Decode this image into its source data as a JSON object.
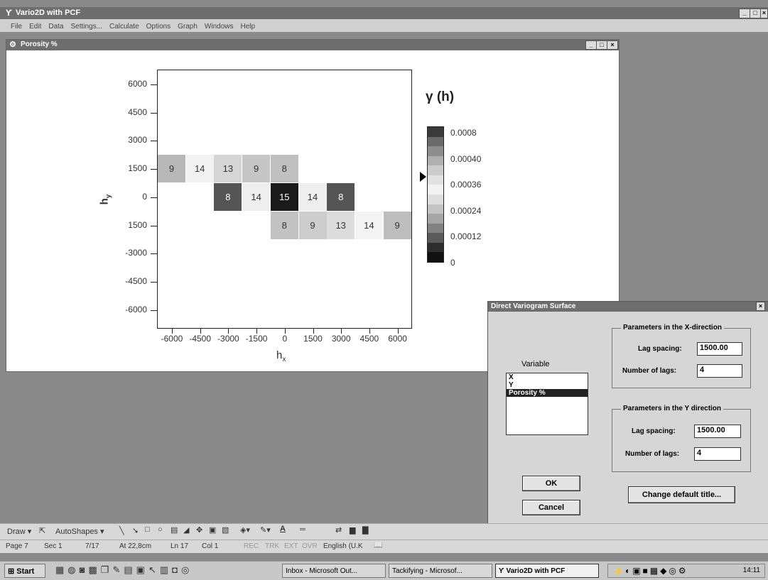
{
  "app": {
    "title": "Vario2D with PCF"
  },
  "menu": [
    "File",
    "Edit",
    "Data",
    "Settings...",
    "Calculate",
    "Options",
    "Graph",
    "Windows",
    "Help"
  ],
  "child_window": {
    "title": "Porosity %"
  },
  "plot": {
    "ylabel": "h",
    "ylabel_sub": "y",
    "xlabel": "h",
    "xlabel_sub": "x",
    "y_ticks": [
      "6000",
      "4500",
      "3000",
      "1500",
      "0",
      "1500",
      "-3000",
      "-4500",
      "-6000"
    ],
    "x_ticks": [
      "-6000",
      "-4500",
      "-3000",
      "-1500",
      "0",
      "1500",
      "3000",
      "4500",
      "6000"
    ],
    "cells": [
      {
        "col": 0,
        "row": 3,
        "label": "9",
        "shade": "#b8b8b8"
      },
      {
        "col": 1,
        "row": 3,
        "label": "14",
        "shade": "#f2f2f2"
      },
      {
        "col": 2,
        "row": 3,
        "label": "13",
        "shade": "#d6d6d6"
      },
      {
        "col": 3,
        "row": 3,
        "label": "9",
        "shade": "#c6c6c6"
      },
      {
        "col": 4,
        "row": 3,
        "label": "8",
        "shade": "#c0c0c0"
      },
      {
        "col": 2,
        "row": 4,
        "label": "8",
        "shade": "#555555"
      },
      {
        "col": 3,
        "row": 4,
        "label": "14",
        "shade": "#eeeeee"
      },
      {
        "col": 4,
        "row": 4,
        "label": "15",
        "shade": "#1a1a1a"
      },
      {
        "col": 5,
        "row": 4,
        "label": "14",
        "shade": "#eeeeee"
      },
      {
        "col": 6,
        "row": 4,
        "label": "8",
        "shade": "#555555"
      },
      {
        "col": 4,
        "row": 5,
        "label": "8",
        "shade": "#c2c2c2"
      },
      {
        "col": 5,
        "row": 5,
        "label": "9",
        "shade": "#cdcdcd"
      },
      {
        "col": 6,
        "row": 5,
        "label": "13",
        "shade": "#dcdcdc"
      },
      {
        "col": 7,
        "row": 5,
        "label": "14",
        "shade": "#f4f4f4"
      },
      {
        "col": 8,
        "row": 5,
        "label": "9",
        "shade": "#bdbdbd"
      }
    ]
  },
  "legend": {
    "title": "γ (h)",
    "labels": [
      "0.0008",
      "0.00040",
      "0.00036",
      "0.00024",
      "0.00012",
      "0"
    ],
    "swatches": [
      "#3a3a3a",
      "#6a6a6a",
      "#8e8e8e",
      "#b0b0b0",
      "#cccccc",
      "#e2e2e2",
      "#f2f2f2",
      "#dedede",
      "#c4c4c4",
      "#a6a6a6",
      "#828282",
      "#5a5a5a",
      "#2e2e2e",
      "#111111"
    ]
  },
  "dialog": {
    "title": "Direct Variogram Surface",
    "close": "×",
    "variable_label": "Variable",
    "variables": [
      "X",
      "Y",
      "Porosity %"
    ],
    "selected_variable": "Porosity %",
    "x_group": {
      "title": "Parameters in the X-direction",
      "lag_label": "Lag spacing:",
      "lag_value": "1500.00",
      "num_label": "Number of lags:",
      "num_value": "4"
    },
    "y_group": {
      "title": "Parameters in the Y direction",
      "lag_label": "Lag spacing:",
      "lag_value": "1500.00",
      "num_label": "Number of lags:",
      "num_value": "4"
    },
    "ok": "OK",
    "cancel": "Cancel",
    "change_title": "Change default title..."
  },
  "drawing_toolbar": {
    "draw": "Draw ▾",
    "autoshapes": "AutoShapes ▾"
  },
  "statusbar": {
    "page": "Page 7",
    "sec": "Sec 1",
    "pages": "7/17",
    "at": "At 22,8cm",
    "ln": "Ln 17",
    "col": "Col 1",
    "rec": "REC",
    "trk": "TRK",
    "ext": "EXT",
    "ovr": "OVR",
    "lang": "English (U.K"
  },
  "taskbar": {
    "start": "Start",
    "tasks": [
      "Inbox - Microsoft Out...",
      "Tackifying - Microsof...",
      "Vario2D with PCF"
    ],
    "clock": "14:11"
  }
}
